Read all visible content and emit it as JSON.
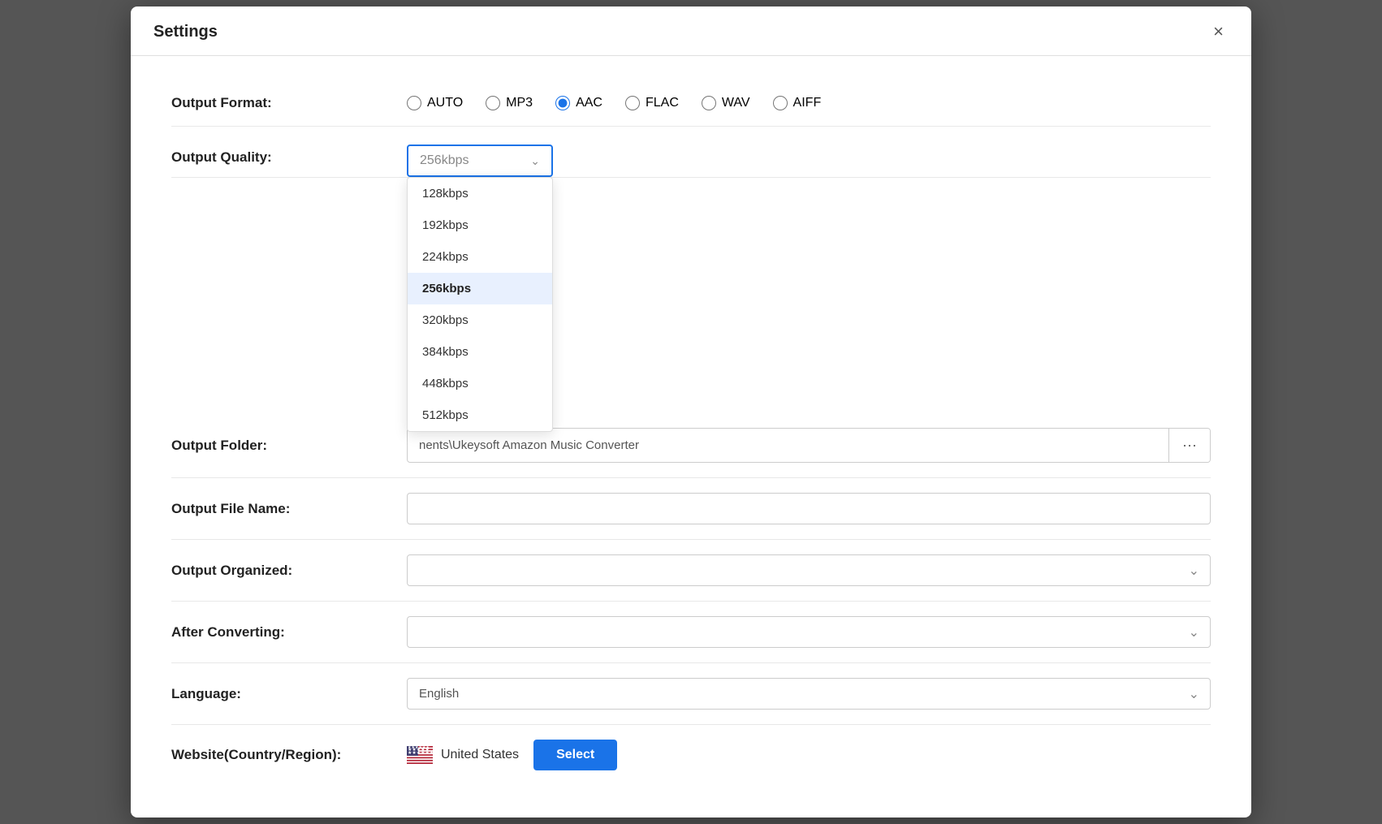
{
  "dialog": {
    "title": "Settings",
    "close_label": "×"
  },
  "output_format": {
    "label": "Output Format:",
    "options": [
      "AUTO",
      "MP3",
      "AAC",
      "FLAC",
      "WAV",
      "AIFF"
    ],
    "selected": "AAC"
  },
  "output_quality": {
    "label": "Output Quality:",
    "selected": "256kbps",
    "options": [
      "128kbps",
      "192kbps",
      "224kbps",
      "256kbps",
      "320kbps",
      "384kbps",
      "448kbps",
      "512kbps"
    ]
  },
  "output_folder": {
    "label": "Output Folder:",
    "path": "nents\\Ukeysoft Amazon Music Converter",
    "browse_icon": "···"
  },
  "output_file_name": {
    "label": "Output File Name:",
    "value": ""
  },
  "output_organized": {
    "label": "Output Organized:",
    "value": ""
  },
  "after_converting": {
    "label": "After Converting:",
    "value": ""
  },
  "language": {
    "label": "Language:",
    "value": "English"
  },
  "website": {
    "label": "Website(Country/Region):",
    "country": "United States",
    "select_btn": "Select"
  },
  "colors": {
    "accent": "#1a73e8",
    "selected_bg": "#e8f0fe"
  }
}
